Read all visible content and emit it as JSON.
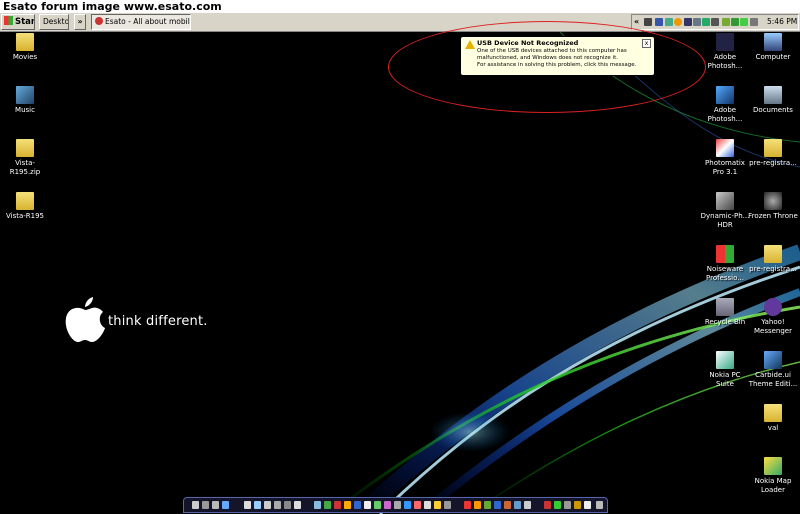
{
  "forum_caption": "Esato forum image www.esato.com",
  "taskbar": {
    "start_label": "Start",
    "desktop_label": "Desktop",
    "chevron_label": "»",
    "task_label": "Esato - All about mobile ...",
    "tray_chevron": "«",
    "clock": "5:46 PM"
  },
  "balloon": {
    "title": "USB Device Not Recognized",
    "line1": "One of the USB devices attached to this computer has",
    "line2": "malfunctioned, and Windows does not recognize it.",
    "line3": "For assistance in solving this problem, click this message.",
    "close": "x"
  },
  "wallpaper_slogan": "think different.",
  "left_icons": [
    "Movies",
    "Music",
    "Vista-R195.zip",
    "Vista-R195"
  ],
  "right_col1": [
    {
      "line1": "Adobe",
      "line2": "Photosh..."
    },
    {
      "line1": "Adobe",
      "line2": "Photosh..."
    },
    {
      "line1": "Photomatix",
      "line2": "Pro 3.1"
    },
    {
      "line1": "Dynamic-Ph...",
      "line2": "HDR"
    },
    {
      "line1": "Noiseware",
      "line2": "Professio..."
    },
    {
      "line1": "Recycle Bin",
      "line2": ""
    },
    {
      "line1": "Nokia PC Suite",
      "line2": ""
    }
  ],
  "right_col2": [
    {
      "line1": "Computer",
      "line2": ""
    },
    {
      "line1": "Documents",
      "line2": ""
    },
    {
      "line1": "pre-registra...",
      "line2": ""
    },
    {
      "line1": "Frozen Throne",
      "line2": ""
    },
    {
      "line1": "pre-registra...",
      "line2": ""
    },
    {
      "line1": "Yahoo!",
      "line2": "Messenger"
    },
    {
      "line1": "Carbide.ui",
      "line2": "Theme Editi..."
    },
    {
      "line1": "val",
      "line2": ""
    },
    {
      "line1": "Nokia Map",
      "line2": "Loader"
    }
  ],
  "colors": {
    "taskbar": "#d8d4c8",
    "balloon": "#ffffe1",
    "warning": "#e2b400",
    "annotation_circle": "#d22222"
  }
}
